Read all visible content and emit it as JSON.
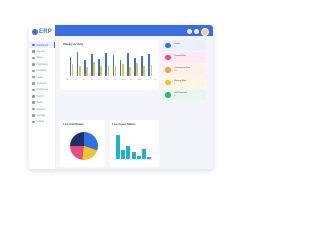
{
  "app": {
    "logo_text": "ERP"
  },
  "sidebar": {
    "items": [
      {
        "label": "Dashboard"
      },
      {
        "label": "Reports"
      },
      {
        "label": "Sales"
      },
      {
        "label": "Purchases"
      },
      {
        "label": "Inventory"
      },
      {
        "label": "Leads"
      },
      {
        "label": "Accounts"
      },
      {
        "label": "Employees"
      },
      {
        "label": "Payroll"
      },
      {
        "label": "Tasks"
      },
      {
        "label": "Projects"
      },
      {
        "label": "Settings"
      },
      {
        "label": "Logout"
      }
    ]
  },
  "activity": {
    "title": "Weekly Activity",
    "ymax": 30,
    "categories": [
      "Mon",
      "Tue",
      "Wed",
      "Thu",
      "Fri",
      "Sat",
      "Sun",
      "Mon",
      "Tue",
      "Wed",
      "Thu",
      "Fri"
    ],
    "series": [
      {
        "color": "#3b6fe0",
        "values": [
          22,
          28,
          18,
          25,
          20,
          26,
          24,
          19,
          27,
          21,
          23,
          25
        ]
      },
      {
        "color": "#f0c330",
        "values": [
          14,
          12,
          10,
          16,
          11,
          13,
          12,
          14,
          10,
          15,
          12,
          13
        ]
      }
    ]
  },
  "stats": [
    {
      "label": "Leads",
      "value": "0",
      "color": "#3b6fe0",
      "bg": "#eaf0ff"
    },
    {
      "label": "Closed Won",
      "value": "0",
      "color": "#e64e79",
      "bg": "#fde9ef"
    },
    {
      "label": "Conversion Rate",
      "value": "0%",
      "color": "#f0a25a",
      "bg": "#fff1e3"
    },
    {
      "label": "Waiting Rate",
      "value": "0",
      "color": "#f0c330",
      "bg": "#fff8df"
    },
    {
      "label": "Call Sessions",
      "value": "0",
      "color": "#2fb86a",
      "bg": "#e5f7ec"
    }
  ],
  "leads_status": {
    "title": "Live Call Status"
  },
  "agent_status": {
    "title": "Live Agent Status",
    "values": [
      22,
      8,
      12,
      6,
      3,
      9,
      2
    ]
  }
}
